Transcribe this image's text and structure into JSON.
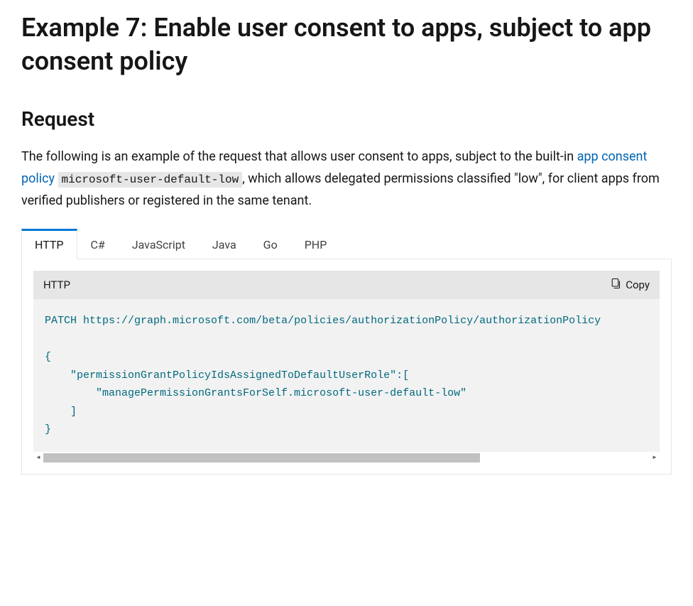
{
  "headings": {
    "h2": "Example 7: Enable user consent to apps, subject to app consent policy",
    "h3": "Request"
  },
  "description": {
    "text_before_link": "The following is an example of the request that allows user consent to apps, subject to the built-in ",
    "link_text": "app consent policy",
    "space": " ",
    "inline_code": "microsoft-user-default-low",
    "text_after_code": ", which allows delegated permissions classified \"low\", for client apps from verified publishers or registered in the same tenant."
  },
  "tabs": {
    "items": [
      {
        "label": "HTTP",
        "active": true
      },
      {
        "label": "C#",
        "active": false
      },
      {
        "label": "JavaScript",
        "active": false
      },
      {
        "label": "Java",
        "active": false
      },
      {
        "label": "Go",
        "active": false
      },
      {
        "label": "PHP",
        "active": false
      }
    ]
  },
  "code_block": {
    "language_label": "HTTP",
    "copy_label": "Copy",
    "lines": {
      "method": "PATCH",
      "url": "https://graph.microsoft.com/beta/policies/authorizationPolicy/authorizationPolicy",
      "brace_open": "{",
      "key_line": "    \"permissionGrantPolicyIdsAssignedToDefaultUserRole\":[",
      "value_line": "        \"managePermissionGrantsForSelf.microsoft-user-default-low\"",
      "array_close": "    ]",
      "brace_close": "}"
    }
  }
}
